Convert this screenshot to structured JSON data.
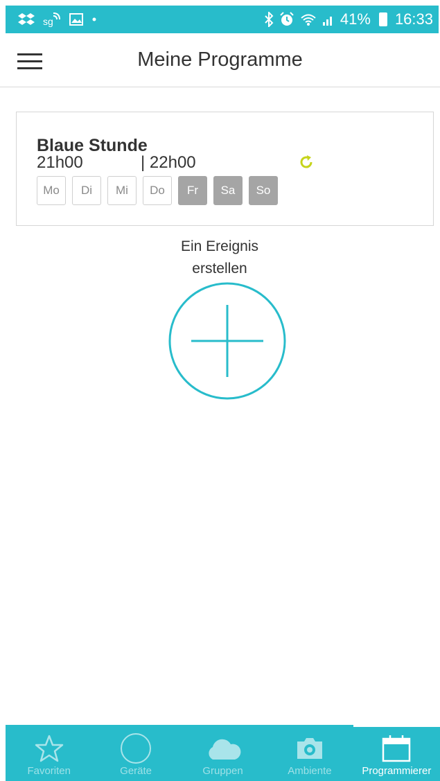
{
  "status_bar": {
    "icons_left": [
      "dropbox-icon",
      "sync-icon",
      "image-icon",
      "dot-icon"
    ],
    "icons_right": [
      "bluetooth-icon",
      "alarm-icon",
      "wifi-icon",
      "signal-icon"
    ],
    "battery": "41%",
    "time": "16:33"
  },
  "header": {
    "title": "Meine Programme"
  },
  "program": {
    "name": "Blaue Stunde",
    "start_time": "21h00",
    "end_time": "| 22h00",
    "days": [
      {
        "label": "Mo",
        "active": false
      },
      {
        "label": "Di",
        "active": false
      },
      {
        "label": "Mi",
        "active": false
      },
      {
        "label": "Do",
        "active": false
      },
      {
        "label": "Fr",
        "active": true
      },
      {
        "label": "Sa",
        "active": true
      },
      {
        "label": "So",
        "active": true
      }
    ],
    "repeat_icon_color": "#c6d41b"
  },
  "add_event": {
    "label_line1": "Ein Ereignis",
    "label_line2": "erstellen",
    "color": "#28bccb"
  },
  "bottom_nav": {
    "items": [
      {
        "label": "Favoriten",
        "icon": "star-icon"
      },
      {
        "label": "Geräte",
        "icon": "circle-icon"
      },
      {
        "label": "Gruppen",
        "icon": "cloud-icon"
      },
      {
        "label": "Ambiente",
        "icon": "camera-icon"
      },
      {
        "label": "Programmierer",
        "icon": "calendar-icon",
        "active": true
      }
    ]
  },
  "colors": {
    "accent": "#28bccb",
    "day_active": "#a5a5a5"
  }
}
